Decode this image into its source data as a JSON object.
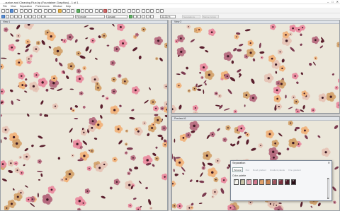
{
  "window": {
    "title": "...aurice and Cleaning Flux.bp (Fountainer Graphics) - 1 of 1",
    "controls": [
      "–",
      "□",
      "✕"
    ]
  },
  "menu": [
    "File",
    "View",
    "Separation",
    "Preferences",
    "Window",
    "Help"
  ],
  "toolbar2": {
    "fill_mode": "Fill mode",
    "aa_mode": "Ansaat",
    "zoom": "33.33 %",
    "disabled_1": "Separations",
    "disabled_2": "Merge Colors"
  },
  "panes": {
    "left_title": "View 1",
    "top_right_title": "View 2",
    "bottom_right_title": "Preview #1"
  },
  "pattern": {
    "background": "#ebe7da",
    "colors": [
      "#e98a9e",
      "#d2a26a",
      "#5a1f2d",
      "#7b3a4f",
      "#f1b27a",
      "#b5697e",
      "#e6c3b5",
      "#3e1a24"
    ]
  },
  "separation_dialog": {
    "title": "Separation",
    "close": "✕",
    "tabs": [
      "Pictorial",
      "Flat",
      "Flood gradient",
      "Gradient palette",
      "Fine gradient"
    ],
    "color_palette_label": "Color palette",
    "swatches": [
      {
        "label": "1",
        "color": "#f6f4ee"
      },
      {
        "label": "2",
        "color": "#c9c3a8"
      },
      {
        "label": "3",
        "color": "#e7a6b3"
      },
      {
        "label": "4",
        "color": "#d1798f"
      },
      {
        "label": "5",
        "color": "#e3a36d"
      },
      {
        "label": "6",
        "color": "#c9824f"
      },
      {
        "label": "7",
        "color": "#a0555f"
      },
      {
        "label": "8",
        "color": "#7b2f3e"
      },
      {
        "label": "9",
        "color": "#4a1b28"
      },
      {
        "label": "10",
        "color": "#2a1018"
      }
    ]
  }
}
